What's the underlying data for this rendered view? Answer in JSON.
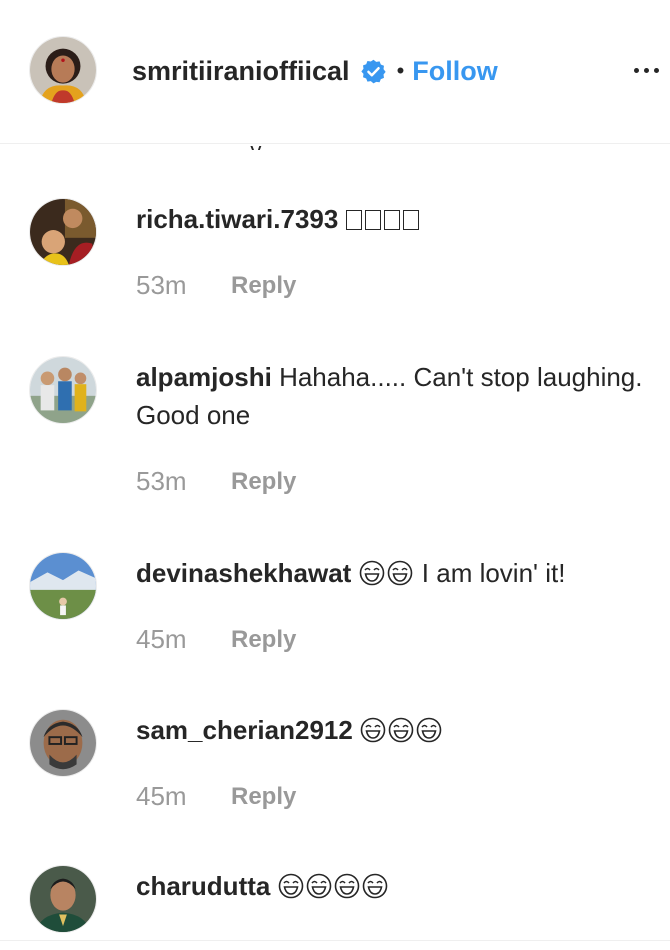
{
  "post_header": {
    "username": "smritiiranioffiical",
    "verified_icon": "verified-badge-icon",
    "separator": "•",
    "follow_label": "Follow",
    "more_icon": "more-options-icon",
    "accent_color": "#3897f0"
  },
  "partial_text": "...y",
  "comments": [
    {
      "username": "richa.tiwari.7393",
      "text": "",
      "emoji_note": "4 unrendered emoji boxes",
      "time": "53m",
      "reply_label": "Reply"
    },
    {
      "username": "alpamjoshi",
      "text": "Hahaha..... Can't stop laughing. Good one",
      "time": "53m",
      "reply_label": "Reply"
    },
    {
      "username": "devinashekhawat",
      "emoji": "😂😂",
      "text": "I am lovin' it!",
      "time": "45m",
      "reply_label": "Reply"
    },
    {
      "username": "sam_cherian2912",
      "emoji": "😂😂😂",
      "text": "",
      "time": "45m",
      "reply_label": "Reply"
    },
    {
      "username": "charudutta",
      "emoji": "😂😂😂😂",
      "text": "",
      "time": "",
      "reply_label": ""
    }
  ]
}
